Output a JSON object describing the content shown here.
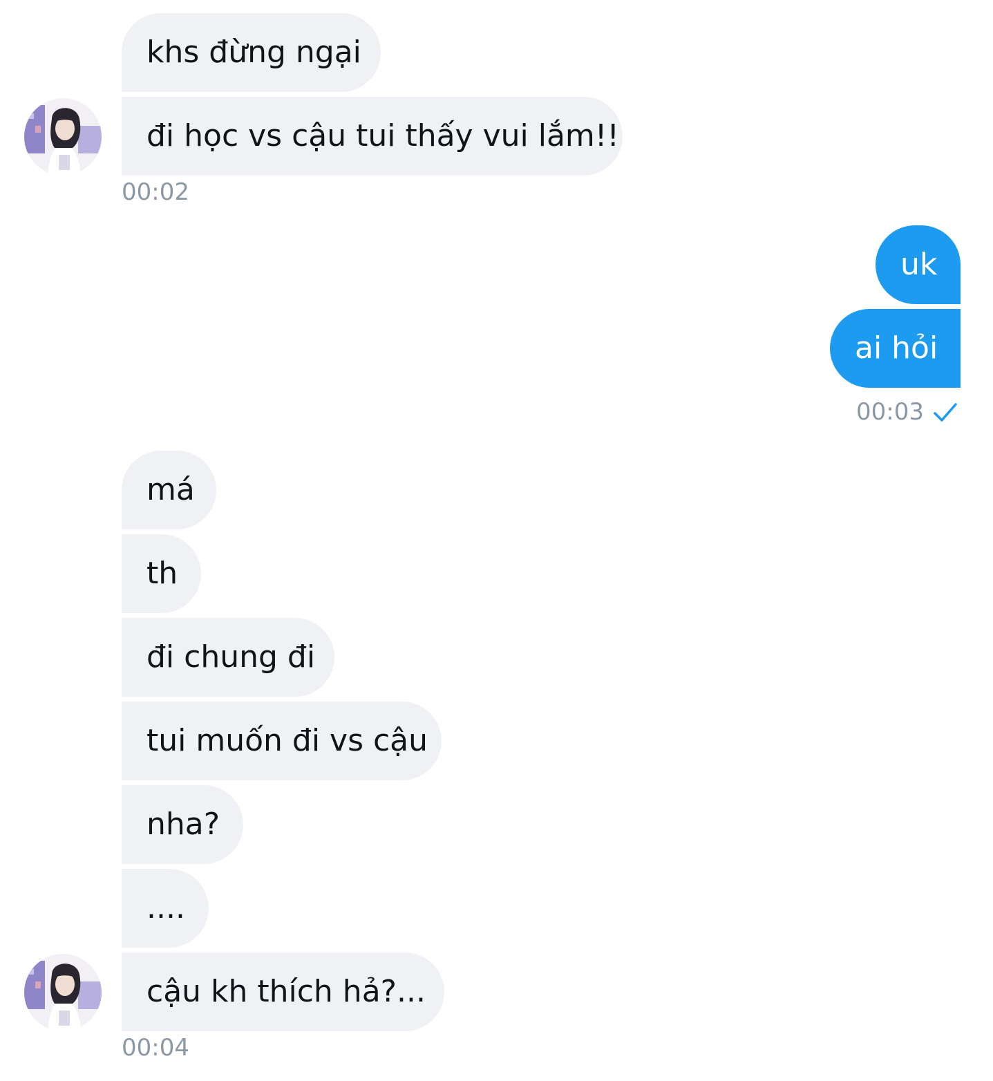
{
  "messages": [
    {
      "text": "khs đừng ngại"
    },
    {
      "text": "đi học vs cậu tui thấy vui lắm!!"
    },
    {
      "text": "uk"
    },
    {
      "text": "ai hỏi"
    },
    {
      "text": "má"
    },
    {
      "text": "th"
    },
    {
      "text": "đi chung đi"
    },
    {
      "text": "tui muốn đi vs cậu"
    },
    {
      "text": "nha?"
    },
    {
      "text": "...."
    },
    {
      "text": "cậu kh thích hả?..."
    }
  ],
  "timestamps": {
    "group1": "00:02",
    "group2": "00:03",
    "group3": "00:04"
  },
  "icons": {
    "avatar": "avatar",
    "read_receipt": "check-icon"
  },
  "colors": {
    "incoming_bubble": "#eff1f4",
    "outgoing_bubble": "#1d9bf0",
    "timestamp": "#8b98a5",
    "check": "#1d9bf0"
  }
}
